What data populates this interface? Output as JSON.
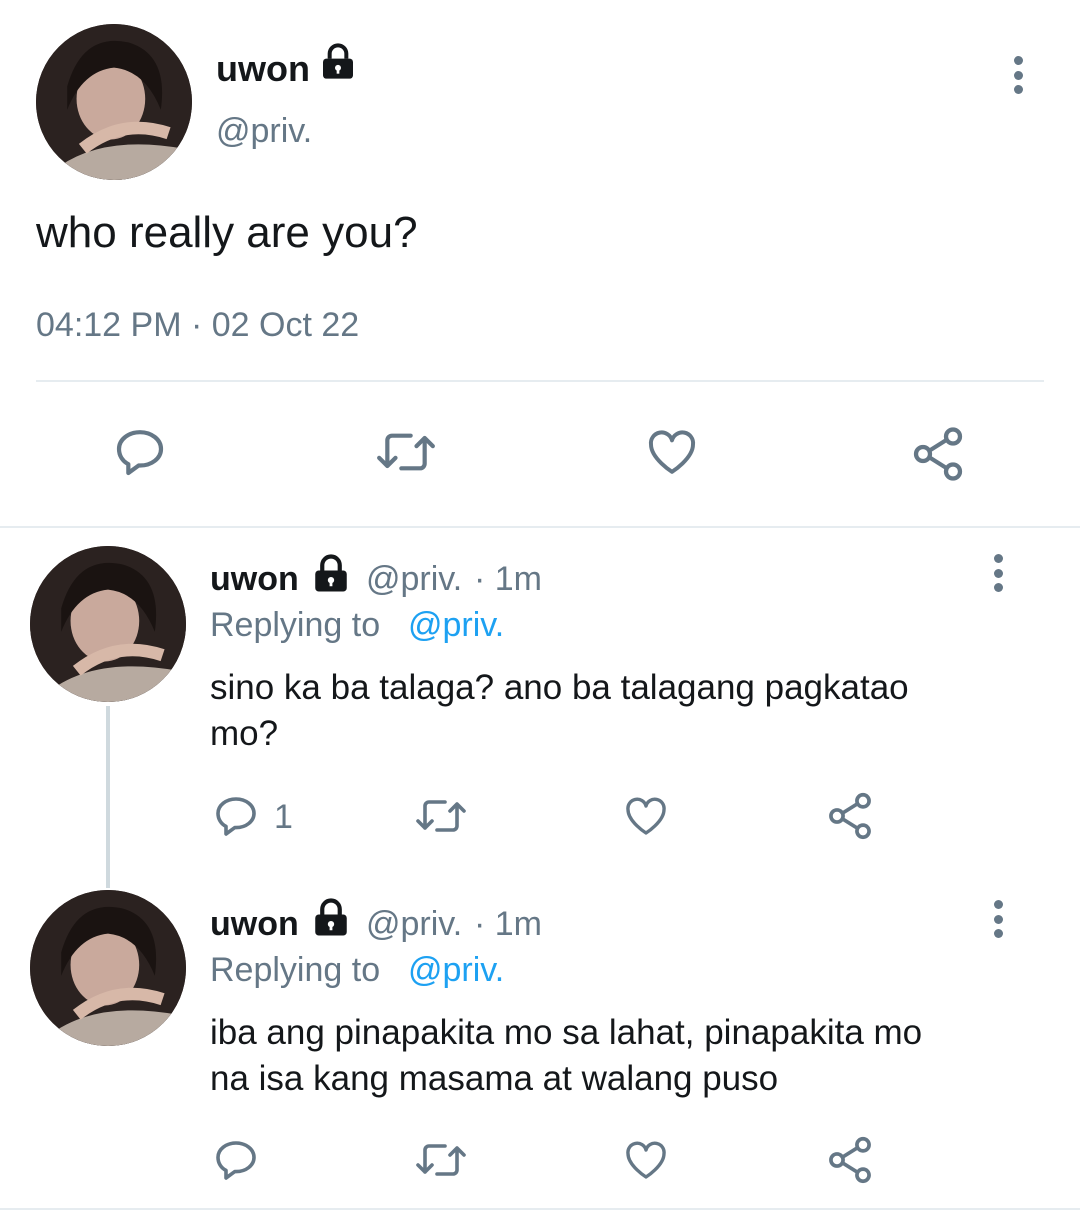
{
  "main_tweet": {
    "display_name": "uwon",
    "handle": "@priv.",
    "text": "who really are you?",
    "timestamp": "04:12 PM · 02 Oct 22",
    "icons": [
      "reply-icon",
      "retweet-icon",
      "like-icon",
      "share-icon"
    ]
  },
  "replies": [
    {
      "display_name": "uwon",
      "handle": "@priv.",
      "time": "· 1m",
      "replying_label": "Replying to",
      "replying_handle": "@priv.",
      "text_line1": "sino ka ba talaga? ano ba talagang pagkatao",
      "text_line2": "mo?",
      "reply_count": "1"
    },
    {
      "display_name": "uwon",
      "handle": "@priv.",
      "time": "· 1m",
      "replying_label": "Replying to",
      "replying_handle": "@priv.",
      "text_line1": "iba ang pinapakita mo sa lahat, pinapakita mo",
      "text_line2": "na isa kang masama at walang puso",
      "reply_count": ""
    }
  ],
  "colors": {
    "text": "#14171a",
    "secondary": "#657786",
    "link": "#1da1f2",
    "divider": "#e6ecf0"
  }
}
